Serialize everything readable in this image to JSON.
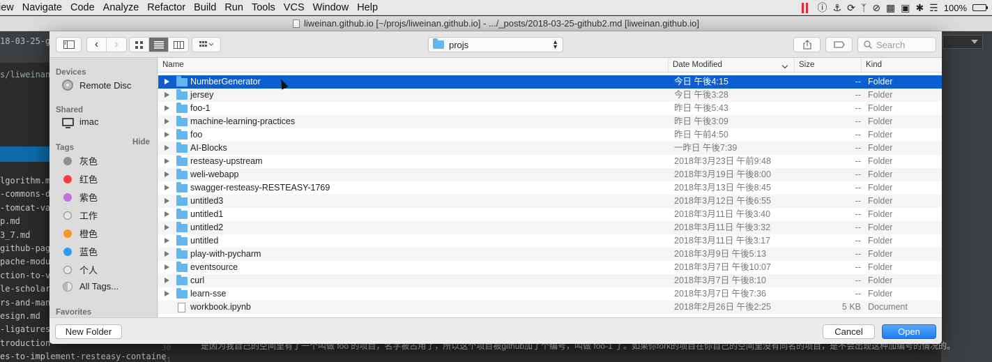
{
  "menubar": {
    "items": [
      "iew",
      "Navigate",
      "Code",
      "Analyze",
      "Refactor",
      "Build",
      "Run",
      "Tools",
      "VCS",
      "Window",
      "Help"
    ],
    "battery": "100%"
  },
  "ide": {
    "window_title": "liweinan.github.io [~/projs/liweinan.github.io] - .../_posts/2018-03-25-github2.md [liweinan.github.io]",
    "tab_peek": "18-03-25-git",
    "path_peek": "s/liweinan.",
    "project_files": [
      "lgorithm.m",
      "-commons-d",
      "-tomcat-va",
      "p.md",
      "3_7.md",
      "github-pag",
      "pache-modu",
      "ction-to-v",
      "le-scholar",
      "rs-and-man",
      "esign.md",
      "-ligatures",
      "troduction",
      "es-to-implement-resteasy-containe"
    ],
    "line_numbers": [
      "30",
      "31"
    ],
    "code_line": "是因为我自己的空间里有了一个叫做 foo 的项目，名字被占用了，所以这个项目被github加了个编号，叫做 foo-1 了。如果你fork的项目在你自己的空间里没有同名的项目，是不会出现这种加编号的情况的。"
  },
  "dialog": {
    "path_popup": "projs",
    "search_placeholder": "Search",
    "sidebar": {
      "devices_heading": "Devices",
      "devices": [
        {
          "label": "Remote Disc",
          "icon": "disc-icon"
        }
      ],
      "shared_heading": "Shared",
      "shared": [
        {
          "label": "imac",
          "icon": "monitor-icon"
        }
      ],
      "tags_heading": "Tags",
      "hide_label": "Hide",
      "tags": [
        {
          "label": "灰色",
          "color": "#8e8e93"
        },
        {
          "label": "红色",
          "color": "#fc3d39"
        },
        {
          "label": "紫色",
          "color": "#c86edf"
        },
        {
          "label": "工作",
          "color": "hollow"
        },
        {
          "label": "橙色",
          "color": "#fd9426"
        },
        {
          "label": "蓝色",
          "color": "#2d9cf5"
        },
        {
          "label": "个人",
          "color": "hollow"
        }
      ],
      "all_tags_label": "All Tags...",
      "favorites_heading": "Favorites"
    },
    "columns": {
      "name": "Name",
      "date": "Date Modified",
      "size": "Size",
      "kind": "Kind"
    },
    "rows": [
      {
        "name": "NumberGenerator",
        "date": "今日 午後4:15",
        "size": "--",
        "kind": "Folder",
        "type": "folder",
        "selected": true
      },
      {
        "name": "jersey",
        "date": "今日 午後3:28",
        "size": "--",
        "kind": "Folder",
        "type": "folder"
      },
      {
        "name": "foo-1",
        "date": "昨日 午後5:43",
        "size": "--",
        "kind": "Folder",
        "type": "folder"
      },
      {
        "name": "machine-learning-practices",
        "date": "昨日 午後3:09",
        "size": "--",
        "kind": "Folder",
        "type": "folder"
      },
      {
        "name": "foo",
        "date": "昨日 午前4:50",
        "size": "--",
        "kind": "Folder",
        "type": "folder"
      },
      {
        "name": "AI-Blocks",
        "date": "一昨日 午後7:39",
        "size": "--",
        "kind": "Folder",
        "type": "folder"
      },
      {
        "name": "resteasy-upstream",
        "date": "2018年3月23日 午前9:48",
        "size": "--",
        "kind": "Folder",
        "type": "folder"
      },
      {
        "name": "weli-webapp",
        "date": "2018年3月19日 午後8:00",
        "size": "--",
        "kind": "Folder",
        "type": "folder"
      },
      {
        "name": "swagger-resteasy-RESTEASY-1769",
        "date": "2018年3月13日 午後8:45",
        "size": "--",
        "kind": "Folder",
        "type": "folder"
      },
      {
        "name": "untitled3",
        "date": "2018年3月12日 午後6:55",
        "size": "--",
        "kind": "Folder",
        "type": "folder"
      },
      {
        "name": "untitled1",
        "date": "2018年3月11日 午後3:40",
        "size": "--",
        "kind": "Folder",
        "type": "folder"
      },
      {
        "name": "untitled2",
        "date": "2018年3月11日 午後3:32",
        "size": "--",
        "kind": "Folder",
        "type": "folder"
      },
      {
        "name": "untitled",
        "date": "2018年3月11日 午後3:17",
        "size": "--",
        "kind": "Folder",
        "type": "folder"
      },
      {
        "name": "play-with-pycharm",
        "date": "2018年3月9日 午後5:13",
        "size": "--",
        "kind": "Folder",
        "type": "folder"
      },
      {
        "name": "eventsource",
        "date": "2018年3月7日 午後10:07",
        "size": "--",
        "kind": "Folder",
        "type": "folder"
      },
      {
        "name": "curl",
        "date": "2018年3月7日 午後8:10",
        "size": "--",
        "kind": "Folder",
        "type": "folder"
      },
      {
        "name": "learn-sse",
        "date": "2018年3月7日 午後7:36",
        "size": "--",
        "kind": "Folder",
        "type": "folder"
      },
      {
        "name": "workbook.ipynb",
        "date": "2018年2月26日 午後2:25",
        "size": "5 KB",
        "kind": "Document",
        "type": "file"
      }
    ],
    "new_folder_label": "New Folder",
    "cancel_label": "Cancel",
    "open_label": "Open"
  },
  "colors": {
    "selection": "#0d5ece",
    "folder": "#62b7f0",
    "primary_button": "#1a7cf2"
  }
}
